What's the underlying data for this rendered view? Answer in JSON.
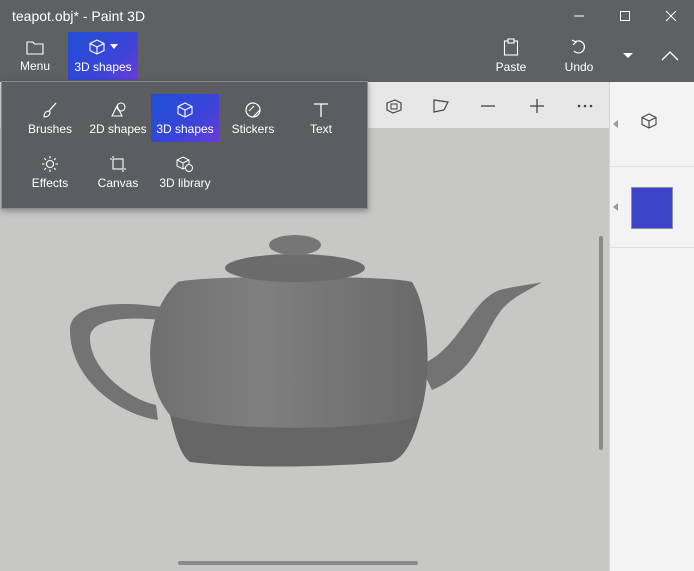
{
  "window": {
    "title": "teapot.obj* - Paint 3D"
  },
  "toolbar": {
    "menu_label": "Menu",
    "shapes3d_label": "3D shapes",
    "paste_label": "Paste",
    "undo_label": "Undo"
  },
  "dropdown": {
    "items": [
      {
        "label": "Brushes"
      },
      {
        "label": "2D shapes"
      },
      {
        "label": "3D shapes"
      },
      {
        "label": "Stickers"
      },
      {
        "label": "Text"
      },
      {
        "label": "Effects"
      },
      {
        "label": "Canvas"
      },
      {
        "label": "3D library"
      }
    ]
  },
  "panel": {
    "color_swatch": "#3b43c9"
  },
  "colors": {
    "accent": "#3a44d8",
    "chrome": "#5f6062",
    "canvas": "#c7c8c6"
  }
}
